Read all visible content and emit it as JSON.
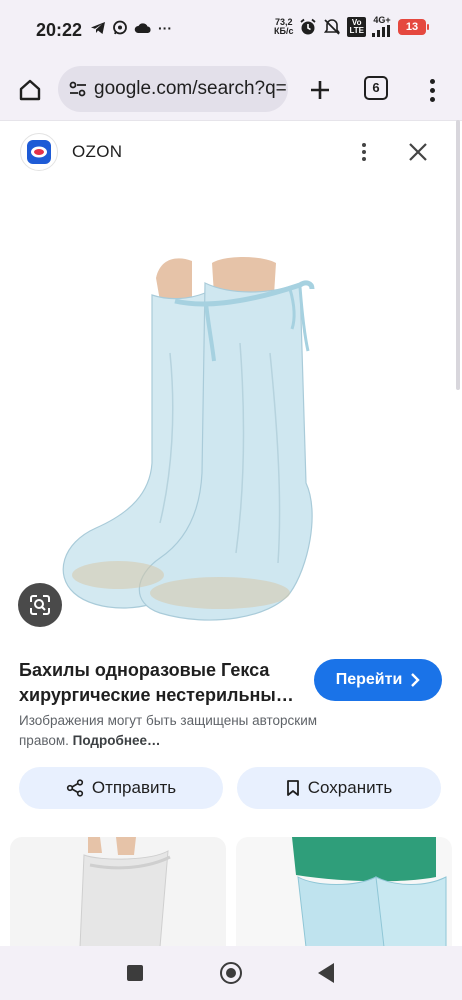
{
  "status_bar": {
    "time": "20:22",
    "net_speed_value": "73,2",
    "net_speed_unit": "КБ/с",
    "network_type": "4G+",
    "volte_top": "Vo",
    "volte_bottom": "LTE",
    "battery_level": "13",
    "more_indicator": "···"
  },
  "browser": {
    "url": "google.com/search?q=",
    "tab_count": "6"
  },
  "result": {
    "source_name": "OZON",
    "title": "Бахилы одноразовые Гекса хирургические нестерильны…",
    "go_button_label": "Перейти",
    "copyright_text": "Изображения могут быть защищены авторским правом.",
    "copyright_link": "Подробнее…",
    "share_label": "Отправить",
    "save_label": "Сохранить"
  },
  "colors": {
    "accent": "#1a73e8",
    "chip_bg": "#e8f0fe",
    "toolbar_bg": "#f3f0f7",
    "battery_low": "#e5483f",
    "product_blue": "#cfe7f0"
  },
  "icons": [
    "telegram-icon",
    "whatsapp-icon",
    "cloud-icon",
    "alarm-icon",
    "mute-icon",
    "signal-icon",
    "home-icon",
    "tune-icon",
    "plus-icon",
    "tabs-icon",
    "menu-icon",
    "more-vert-icon",
    "close-icon",
    "lens-icon",
    "chevron-right-icon",
    "share-icon",
    "bookmark-icon"
  ]
}
